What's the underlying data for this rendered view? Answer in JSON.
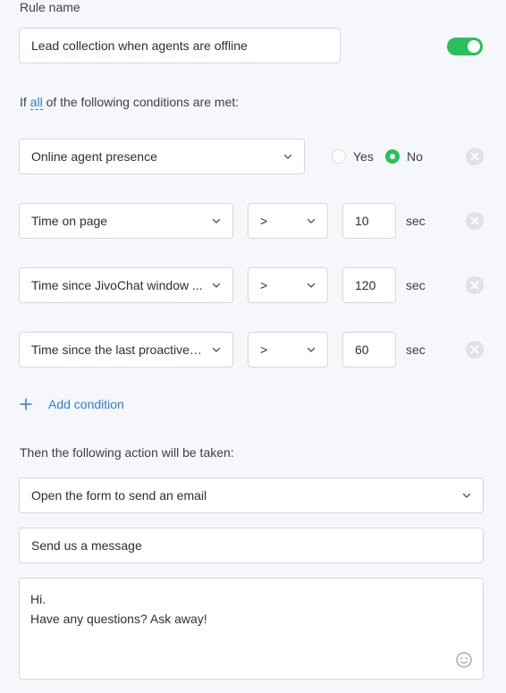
{
  "rule_name": {
    "label": "Rule name",
    "value": "Lead collection when agents are offline",
    "enabled": true
  },
  "conditions_header": {
    "prefix": "If",
    "quantifier": "all",
    "suffix": "of the following conditions are met:"
  },
  "conditions": [
    {
      "field": "Online agent presence",
      "options": [
        "Yes",
        "No"
      ],
      "selected": "No"
    },
    {
      "field": "Time on page",
      "operator": ">",
      "value": "10",
      "unit": "sec"
    },
    {
      "field": "Time since JivoChat window ...",
      "operator": ">",
      "value": "120",
      "unit": "sec"
    },
    {
      "field": "Time since the last proactive i...",
      "operator": ">",
      "value": "60",
      "unit": "sec"
    }
  ],
  "add_condition_label": "Add condition",
  "action": {
    "label": "Then the following action will be taken:",
    "selected": "Open the form to send an email",
    "title_value": "Send us a message",
    "message_lines": [
      "Hi.",
      "Have any questions? Ask away!"
    ]
  },
  "colors": {
    "accent_green": "#27c05a",
    "link_blue": "#2e7fd8"
  }
}
